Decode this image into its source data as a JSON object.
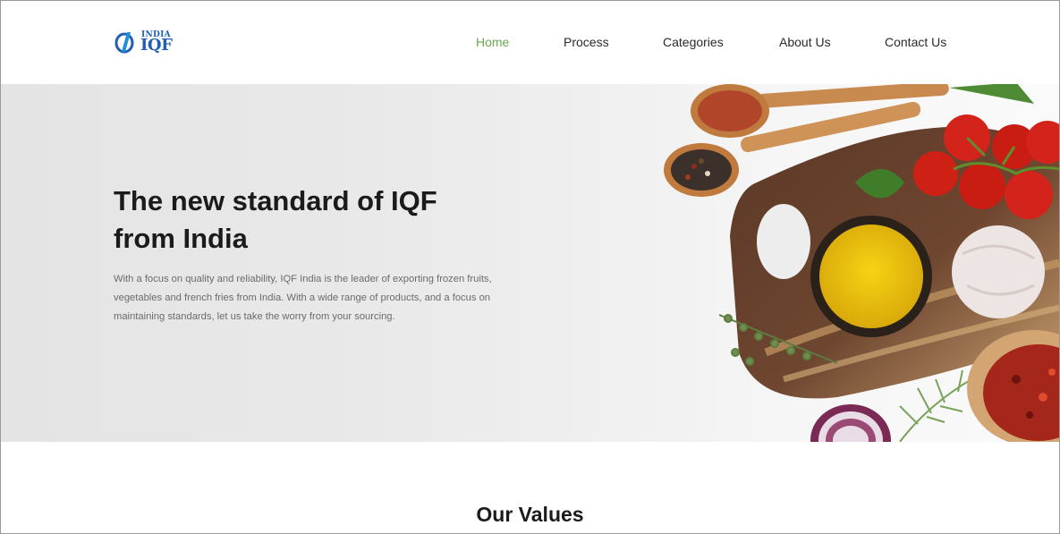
{
  "brand": {
    "logo_top": "INDIA",
    "logo_main": "IQF"
  },
  "nav": {
    "items": [
      {
        "label": "Home",
        "active": true
      },
      {
        "label": "Process",
        "active": false
      },
      {
        "label": "Categories",
        "active": false
      },
      {
        "label": "About Us",
        "active": false
      },
      {
        "label": "Contact Us",
        "active": false
      }
    ]
  },
  "hero": {
    "title": "The new standard of IQF from India",
    "description": "With a focus on quality and reliability, IQF India is the leader of exporting frozen fruits, vegetables and french fries from India. With a wide range of products, and a focus on maintaining standards, let us take the worry from your sourcing.",
    "image": "spices-cutting-board-photo"
  },
  "values": {
    "title": "Our Values"
  },
  "colors": {
    "accent": "#6aa84f",
    "brand_blue": "#1f5fb8",
    "text_dark": "#1b1b1b"
  }
}
